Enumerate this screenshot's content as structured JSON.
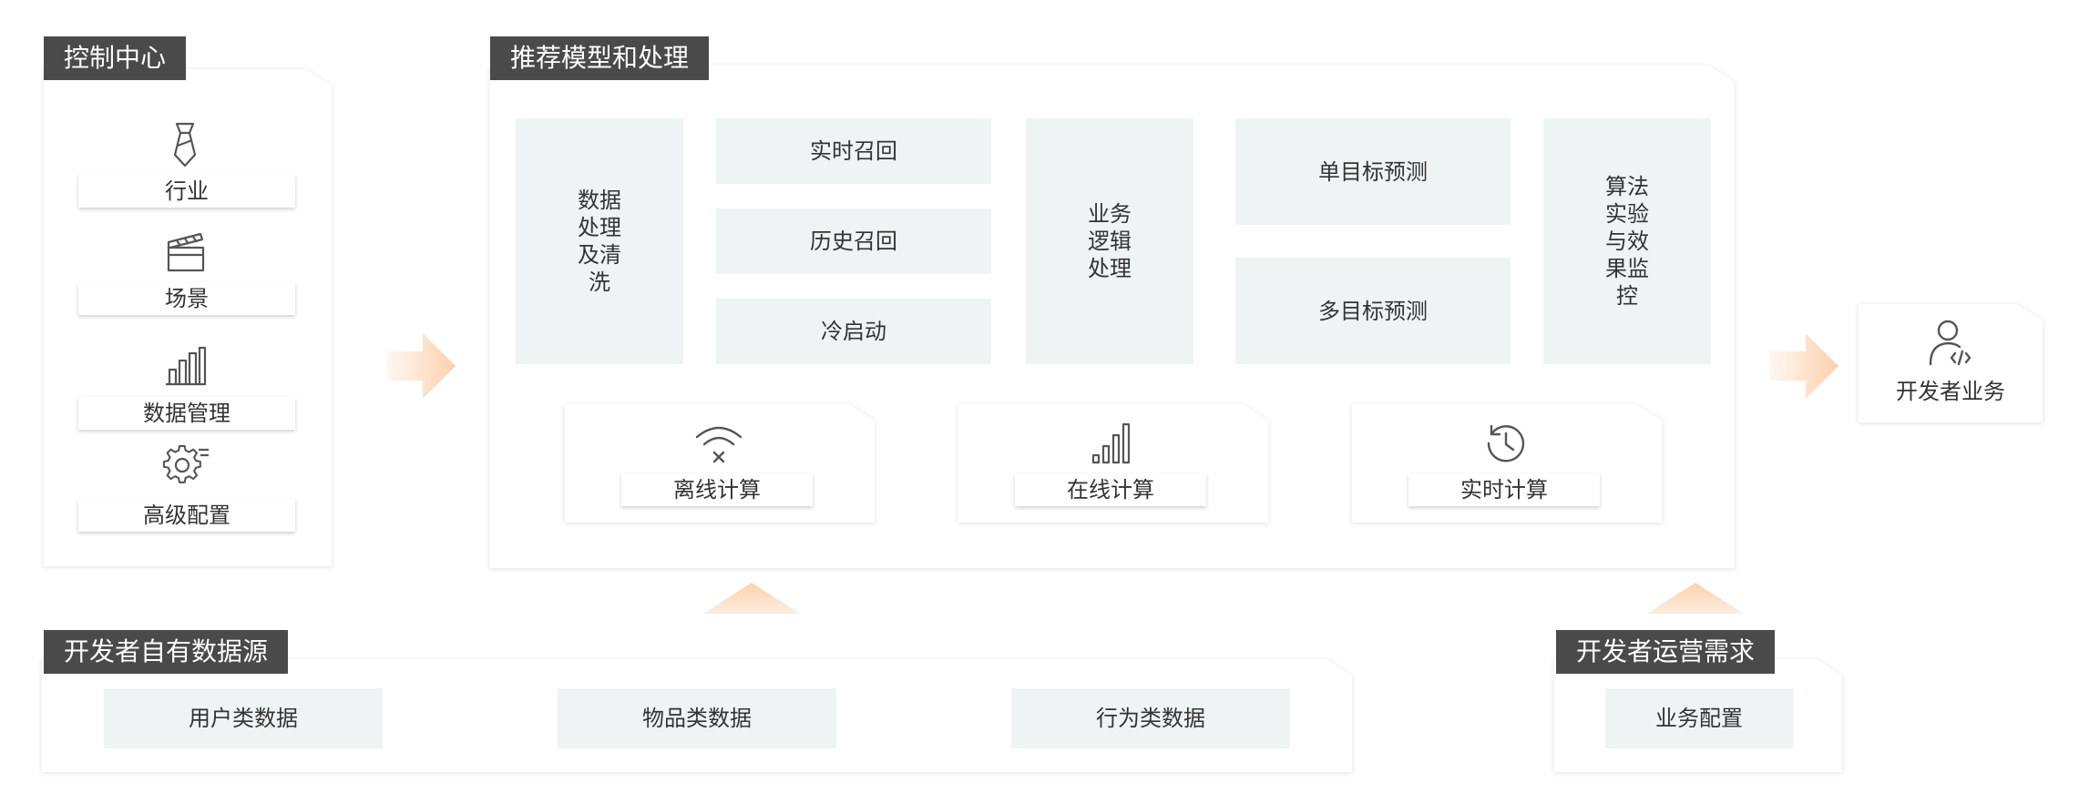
{
  "control_center": {
    "title": "控制中心",
    "items": [
      {
        "label": "行业",
        "icon": "tie-icon"
      },
      {
        "label": "场景",
        "icon": "clapperboard-icon"
      },
      {
        "label": "数据管理",
        "icon": "bar-chart-icon"
      },
      {
        "label": "高级配置",
        "icon": "gear-icon"
      }
    ]
  },
  "model": {
    "title": "推荐模型和处理",
    "data_processing": "数据处理及清洗",
    "recall": [
      "实时召回",
      "历史召回",
      "冷启动"
    ],
    "business_logic": "业务逻辑处理",
    "prediction": [
      "单目标预测",
      "多目标预测"
    ],
    "experiment": "算法实验与效果监控",
    "compute": [
      {
        "label": "离线计算",
        "icon": "wifi-off-icon"
      },
      {
        "label": "在线计算",
        "icon": "signal-bars-icon"
      },
      {
        "label": "实时计算",
        "icon": "history-clock-icon"
      }
    ]
  },
  "developer_business": {
    "label": "开发者业务",
    "icon": "developer-user-icon"
  },
  "data_sources": {
    "title": "开发者自有数据源",
    "items": [
      "用户类数据",
      "物品类数据",
      "行为类数据"
    ]
  },
  "ops_needs": {
    "title": "开发者运营需求",
    "items": [
      "业务配置"
    ]
  },
  "colors": {
    "tag_bg": "#4a4a4a",
    "cell_bg": "#eef4f4",
    "arrow": "#fcd1ad",
    "icon": "#555555"
  }
}
